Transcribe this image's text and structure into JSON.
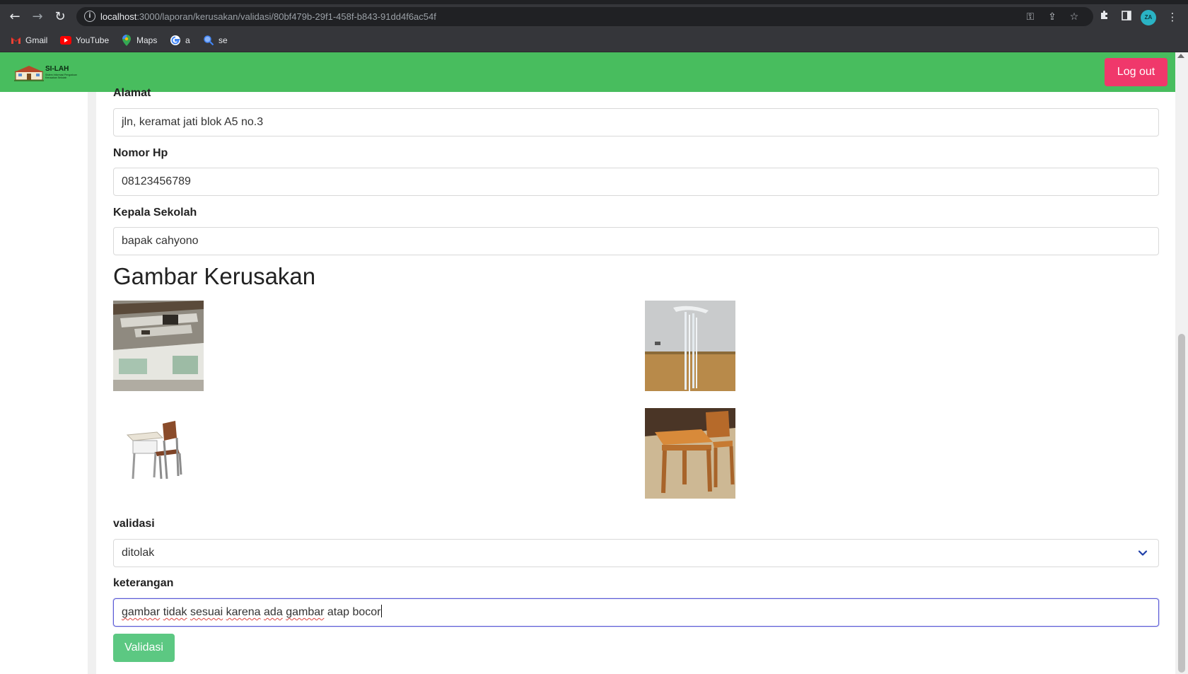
{
  "browser": {
    "url_host": "localhost",
    "url_path": ":3000/laporan/kerusakan/validasi/80bf479b-29f1-458f-b843-91dd4f6ac54f",
    "profile_initials": "ZA",
    "bookmarks": [
      {
        "label": "Gmail",
        "icon": "gmail-icon"
      },
      {
        "label": "YouTube",
        "icon": "youtube-icon"
      },
      {
        "label": "Maps",
        "icon": "maps-icon"
      },
      {
        "label": "a",
        "icon": "google-icon"
      },
      {
        "label": "se",
        "icon": "search-icon"
      }
    ]
  },
  "app": {
    "logo_title": "SI-LAH",
    "logo_subtitle": "Sistem Informasi Pengaduan Kerusakan Sekolah",
    "logout_label": "Log out",
    "brand_color": "#48bd5e",
    "logout_color": "#f0386b"
  },
  "form": {
    "alamat": {
      "label": "Alamat",
      "value": "jln, keramat jati blok A5 no.3"
    },
    "nomor_hp": {
      "label": "Nomor Hp",
      "value": "08123456789"
    },
    "kepala_sekolah": {
      "label": "Kepala Sekolah",
      "value": "bapak cahyono"
    },
    "gallery_title": "Gambar Kerusakan",
    "images": [
      {
        "name": "damaged-ceiling-classroom"
      },
      {
        "name": "leaking-ceiling-water"
      },
      {
        "name": "student-desk-chair"
      },
      {
        "name": "wooden-desk-chair"
      }
    ],
    "validasi": {
      "label": "validasi",
      "selected": "ditolak"
    },
    "keterangan": {
      "label": "keterangan",
      "words": [
        "gambar",
        "tidak",
        "sesuai",
        "karena",
        "ada",
        "gambar",
        "atap",
        "bocor"
      ],
      "value": "gambar tidak sesuai karena ada gambar atap bocor"
    },
    "submit_label": "Validasi"
  }
}
